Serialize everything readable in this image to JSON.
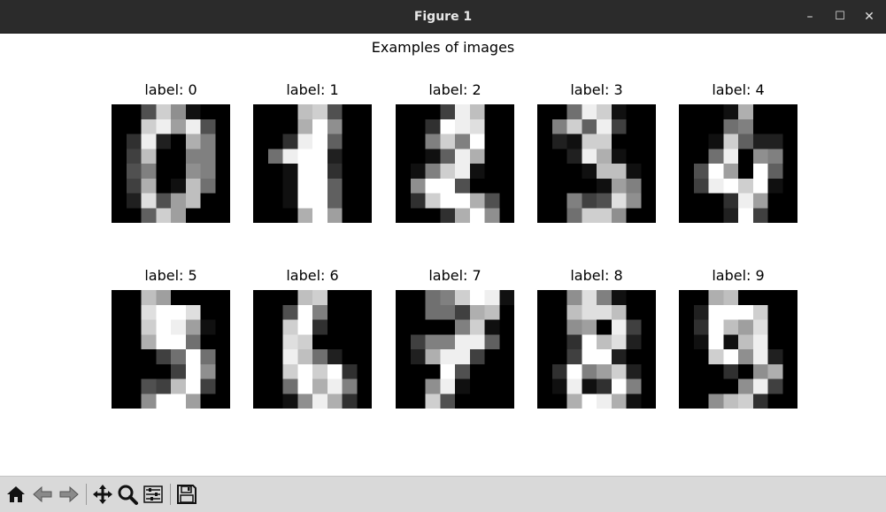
{
  "window": {
    "title": "Figure 1",
    "minimize_glyph": "–",
    "maximize_glyph": "☐",
    "close_glyph": "✕"
  },
  "figure": {
    "suptitle": "Examples of images",
    "panels": [
      {
        "label": "label: 0",
        "pixels": [
          [
            0,
            0,
            5,
            13,
            9,
            1,
            0,
            0
          ],
          [
            0,
            0,
            13,
            15,
            10,
            15,
            5,
            0
          ],
          [
            0,
            3,
            15,
            2,
            0,
            11,
            8,
            0
          ],
          [
            0,
            4,
            12,
            0,
            0,
            8,
            8,
            0
          ],
          [
            0,
            5,
            8,
            0,
            0,
            9,
            8,
            0
          ],
          [
            0,
            4,
            11,
            0,
            1,
            12,
            7,
            0
          ],
          [
            0,
            2,
            14,
            5,
            10,
            12,
            0,
            0
          ],
          [
            0,
            0,
            6,
            13,
            10,
            0,
            0,
            0
          ]
        ]
      },
      {
        "label": "label: 1",
        "pixels": [
          [
            0,
            0,
            0,
            12,
            13,
            5,
            0,
            0
          ],
          [
            0,
            0,
            0,
            11,
            16,
            9,
            0,
            0
          ],
          [
            0,
            0,
            3,
            15,
            16,
            6,
            0,
            0
          ],
          [
            0,
            7,
            15,
            16,
            16,
            2,
            0,
            0
          ],
          [
            0,
            0,
            1,
            16,
            16,
            3,
            0,
            0
          ],
          [
            0,
            0,
            1,
            16,
            16,
            6,
            0,
            0
          ],
          [
            0,
            0,
            1,
            16,
            16,
            6,
            0,
            0
          ],
          [
            0,
            0,
            0,
            11,
            16,
            10,
            0,
            0
          ]
        ]
      },
      {
        "label": "label: 2",
        "pixels": [
          [
            0,
            0,
            0,
            4,
            15,
            12,
            0,
            0
          ],
          [
            0,
            0,
            3,
            16,
            15,
            14,
            0,
            0
          ],
          [
            0,
            0,
            8,
            13,
            8,
            16,
            0,
            0
          ],
          [
            0,
            0,
            1,
            6,
            15,
            11,
            0,
            0
          ],
          [
            0,
            1,
            8,
            13,
            15,
            1,
            0,
            0
          ],
          [
            0,
            9,
            16,
            16,
            5,
            0,
            0,
            0
          ],
          [
            0,
            3,
            13,
            16,
            16,
            11,
            5,
            0
          ],
          [
            0,
            0,
            0,
            3,
            11,
            16,
            9,
            0
          ]
        ]
      },
      {
        "label": "label: 3",
        "pixels": [
          [
            0,
            0,
            7,
            15,
            13,
            1,
            0,
            0
          ],
          [
            0,
            8,
            13,
            6,
            15,
            4,
            0,
            0
          ],
          [
            0,
            2,
            1,
            13,
            13,
            0,
            0,
            0
          ],
          [
            0,
            0,
            2,
            15,
            11,
            1,
            0,
            0
          ],
          [
            0,
            0,
            0,
            1,
            12,
            12,
            1,
            0
          ],
          [
            0,
            0,
            0,
            0,
            1,
            10,
            8,
            0
          ],
          [
            0,
            0,
            8,
            4,
            5,
            14,
            9,
            0
          ],
          [
            0,
            0,
            7,
            13,
            13,
            9,
            0,
            0
          ]
        ]
      },
      {
        "label": "label: 4",
        "pixels": [
          [
            0,
            0,
            0,
            1,
            11,
            0,
            0,
            0
          ],
          [
            0,
            0,
            0,
            7,
            8,
            0,
            0,
            0
          ],
          [
            0,
            0,
            1,
            13,
            6,
            2,
            2,
            0
          ],
          [
            0,
            0,
            7,
            15,
            0,
            9,
            8,
            0
          ],
          [
            0,
            5,
            16,
            10,
            0,
            16,
            6,
            0
          ],
          [
            0,
            4,
            15,
            16,
            13,
            16,
            1,
            0
          ],
          [
            0,
            0,
            0,
            3,
            15,
            10,
            0,
            0
          ],
          [
            0,
            0,
            0,
            2,
            16,
            4,
            0,
            0
          ]
        ]
      },
      {
        "label": "label: 5",
        "pixels": [
          [
            0,
            0,
            12,
            10,
            0,
            0,
            0,
            0
          ],
          [
            0,
            0,
            14,
            16,
            16,
            14,
            0,
            0
          ],
          [
            0,
            0,
            13,
            16,
            15,
            10,
            1,
            0
          ],
          [
            0,
            0,
            11,
            16,
            16,
            7,
            0,
            0
          ],
          [
            0,
            0,
            0,
            4,
            7,
            16,
            7,
            0
          ],
          [
            0,
            0,
            0,
            0,
            4,
            16,
            9,
            0
          ],
          [
            0,
            0,
            5,
            4,
            12,
            16,
            4,
            0
          ],
          [
            0,
            0,
            9,
            16,
            16,
            10,
            0,
            0
          ]
        ]
      },
      {
        "label": "label: 6",
        "pixels": [
          [
            0,
            0,
            0,
            12,
            13,
            0,
            0,
            0
          ],
          [
            0,
            0,
            5,
            16,
            8,
            0,
            0,
            0
          ],
          [
            0,
            0,
            13,
            16,
            3,
            0,
            0,
            0
          ],
          [
            0,
            0,
            14,
            13,
            0,
            0,
            0,
            0
          ],
          [
            0,
            0,
            15,
            12,
            7,
            2,
            0,
            0
          ],
          [
            0,
            0,
            13,
            16,
            13,
            16,
            3,
            0
          ],
          [
            0,
            0,
            7,
            16,
            11,
            15,
            8,
            0
          ],
          [
            0,
            0,
            1,
            9,
            15,
            11,
            3,
            0
          ]
        ]
      },
      {
        "label": "label: 7",
        "pixels": [
          [
            0,
            0,
            7,
            8,
            13,
            16,
            15,
            1
          ],
          [
            0,
            0,
            7,
            7,
            4,
            11,
            12,
            0
          ],
          [
            0,
            0,
            0,
            0,
            8,
            13,
            1,
            0
          ],
          [
            0,
            4,
            8,
            8,
            15,
            15,
            6,
            0
          ],
          [
            0,
            2,
            11,
            15,
            15,
            4,
            0,
            0
          ],
          [
            0,
            0,
            0,
            16,
            5,
            0,
            0,
            0
          ],
          [
            0,
            0,
            9,
            15,
            1,
            0,
            0,
            0
          ],
          [
            0,
            0,
            13,
            5,
            0,
            0,
            0,
            0
          ]
        ]
      },
      {
        "label": "label: 8",
        "pixels": [
          [
            0,
            0,
            9,
            14,
            8,
            1,
            0,
            0
          ],
          [
            0,
            0,
            12,
            14,
            14,
            12,
            0,
            0
          ],
          [
            0,
            0,
            9,
            10,
            0,
            15,
            4,
            0
          ],
          [
            0,
            0,
            3,
            16,
            12,
            14,
            2,
            0
          ],
          [
            0,
            0,
            4,
            16,
            16,
            2,
            0,
            0
          ],
          [
            0,
            3,
            16,
            8,
            10,
            13,
            2,
            0
          ],
          [
            0,
            1,
            15,
            1,
            3,
            16,
            8,
            0
          ],
          [
            0,
            0,
            11,
            16,
            15,
            11,
            1,
            0
          ]
        ]
      },
      {
        "label": "label: 9",
        "pixels": [
          [
            0,
            0,
            11,
            12,
            0,
            0,
            0,
            0
          ],
          [
            0,
            2,
            16,
            16,
            16,
            13,
            0,
            0
          ],
          [
            0,
            3,
            16,
            12,
            10,
            14,
            0,
            0
          ],
          [
            0,
            1,
            16,
            1,
            12,
            15,
            0,
            0
          ],
          [
            0,
            0,
            13,
            16,
            9,
            15,
            2,
            0
          ],
          [
            0,
            0,
            0,
            3,
            0,
            9,
            11,
            0
          ],
          [
            0,
            0,
            0,
            0,
            9,
            15,
            4,
            0
          ],
          [
            0,
            0,
            9,
            12,
            13,
            3,
            0,
            0
          ]
        ]
      }
    ]
  },
  "toolbar": {
    "buttons": [
      {
        "name": "home-button",
        "icon": "home-icon"
      },
      {
        "name": "back-button",
        "icon": "arrow-left-icon"
      },
      {
        "name": "forward-button",
        "icon": "arrow-right-icon"
      },
      {
        "name": "pan-button",
        "icon": "move-icon"
      },
      {
        "name": "zoom-button",
        "icon": "magnifier-icon"
      },
      {
        "name": "configure-subplots-button",
        "icon": "sliders-icon"
      },
      {
        "name": "save-button",
        "icon": "floppy-icon"
      }
    ]
  }
}
